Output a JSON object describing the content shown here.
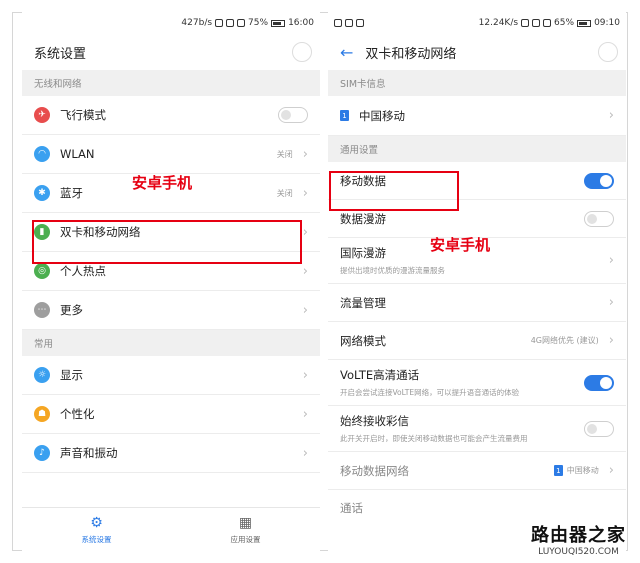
{
  "left": {
    "status": {
      "speed": "427b/s",
      "battery": "75%",
      "time": "16:00"
    },
    "title": "系统设置",
    "section1": "无线和网络",
    "rows1": [
      {
        "label": "飞行模式",
        "value": "",
        "color": "#e84d4d",
        "glyph": "✈"
      },
      {
        "label": "WLAN",
        "value": "关闭",
        "color": "#3aa0f0",
        "glyph": "◠"
      },
      {
        "label": "蓝牙",
        "value": "关闭",
        "color": "#3aa0f0",
        "glyph": "✱"
      },
      {
        "label": "双卡和移动网络",
        "value": "",
        "color": "#4caf50",
        "glyph": "▮"
      },
      {
        "label": "个人热点",
        "value": "",
        "color": "#4caf50",
        "glyph": "◎"
      },
      {
        "label": "更多",
        "value": "",
        "color": "#9e9e9e",
        "glyph": "⋯"
      }
    ],
    "section2": "常用",
    "rows2": [
      {
        "label": "显示",
        "color": "#3aa0f0",
        "glyph": "☼"
      },
      {
        "label": "个性化",
        "color": "#f5a623",
        "glyph": "☗"
      },
      {
        "label": "声音和振动",
        "color": "#3aa0f0",
        "glyph": "♪"
      }
    ],
    "annotation": "安卓手机",
    "nav": [
      {
        "label": "系统设置"
      },
      {
        "label": "应用设置"
      }
    ]
  },
  "right": {
    "status": {
      "speed": "12.24K/s",
      "battery": "65%",
      "time": "09:10"
    },
    "title": "双卡和移动网络",
    "section1": "SIM卡信息",
    "sim_row": "中国移动",
    "section2": "通用设置",
    "rows": [
      {
        "label": "移动数据",
        "sub": "",
        "value": "",
        "control": "toggle-on"
      },
      {
        "label": "数据漫游",
        "sub": "",
        "value": "",
        "control": "toggle-off"
      },
      {
        "label": "国际漫游",
        "sub": "提供出境时优质的漫游流量服务",
        "value": "",
        "control": "chevron"
      },
      {
        "label": "流量管理",
        "sub": "",
        "value": "",
        "control": "chevron"
      },
      {
        "label": "网络模式",
        "sub": "",
        "value": "4G网络优先 (建议)",
        "control": "chevron"
      },
      {
        "label": "VoLTE高清通话",
        "sub": "开启会尝试连接VoLTE网络，可以提升语音通话的体验",
        "value": "",
        "control": "toggle-on"
      },
      {
        "label": "始终接收彩信",
        "sub": "此开关开启时，即使关闭移动数据也可能会产生流量费用",
        "value": "",
        "control": "toggle-off"
      },
      {
        "label": "移动数据网络",
        "sub": "",
        "value": "中国移动",
        "control": "chevron"
      }
    ],
    "last_row": "通话",
    "annotation": "安卓手机"
  },
  "watermark": {
    "line1": "路由器之家",
    "line2": "LUYOUQI520.COM"
  },
  "colors": {
    "accent": "#2c7be5",
    "annotation": "#e60012"
  }
}
